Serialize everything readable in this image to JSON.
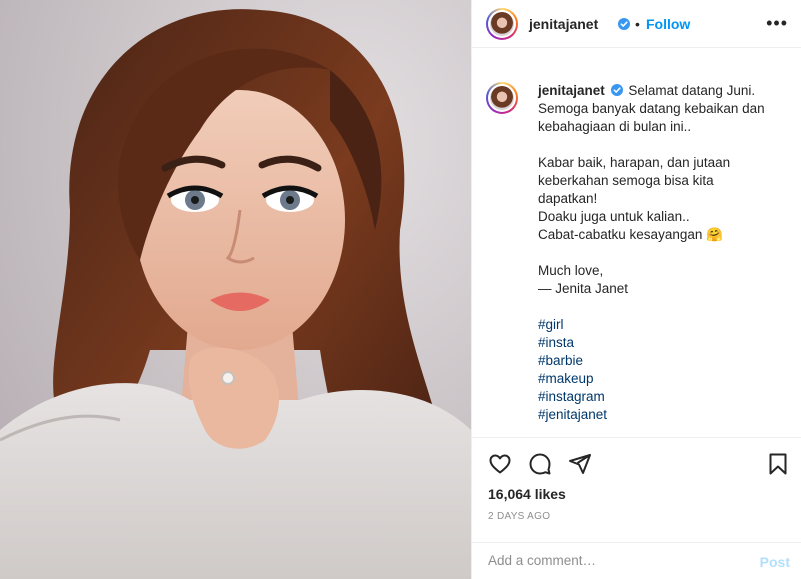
{
  "post": {
    "image_alt": "Portrait photo of woman in white knit sweater",
    "colors": {
      "link": "#0095f6",
      "hashtag": "#00376b",
      "muted": "#8e8e8e",
      "verified": "#3897f0"
    }
  },
  "header": {
    "username": "jenitajanet",
    "separator": "•",
    "follow_label": "Follow",
    "more_label": "•••"
  },
  "caption": {
    "username": "jenitajanet",
    "lines": [
      "Selamat datang Juni.",
      "Semoga banyak datang kebaikan dan",
      "kebahagiaan di bulan ini..",
      "",
      "Kabar baik, harapan, dan jutaan",
      "keberkahan semoga bisa kita",
      "dapatkan!",
      "Doaku juga untuk kalian..",
      "Cabat-cabatku kesayangan 🤗",
      "",
      "Much love,",
      "— Jenita Janet",
      ""
    ],
    "hashtags": [
      "#girl",
      "#insta",
      "#barbie",
      "#makeup",
      "#instagram",
      "#jenitajanet"
    ]
  },
  "actions": {
    "like_icon": "heart-icon",
    "comment_icon": "comment-icon",
    "share_icon": "share-icon",
    "save_icon": "bookmark-icon",
    "likes": "16,064 likes",
    "time": "2 DAYS AGO"
  },
  "comment": {
    "placeholder": "Add a comment…",
    "post_label": "Post"
  }
}
